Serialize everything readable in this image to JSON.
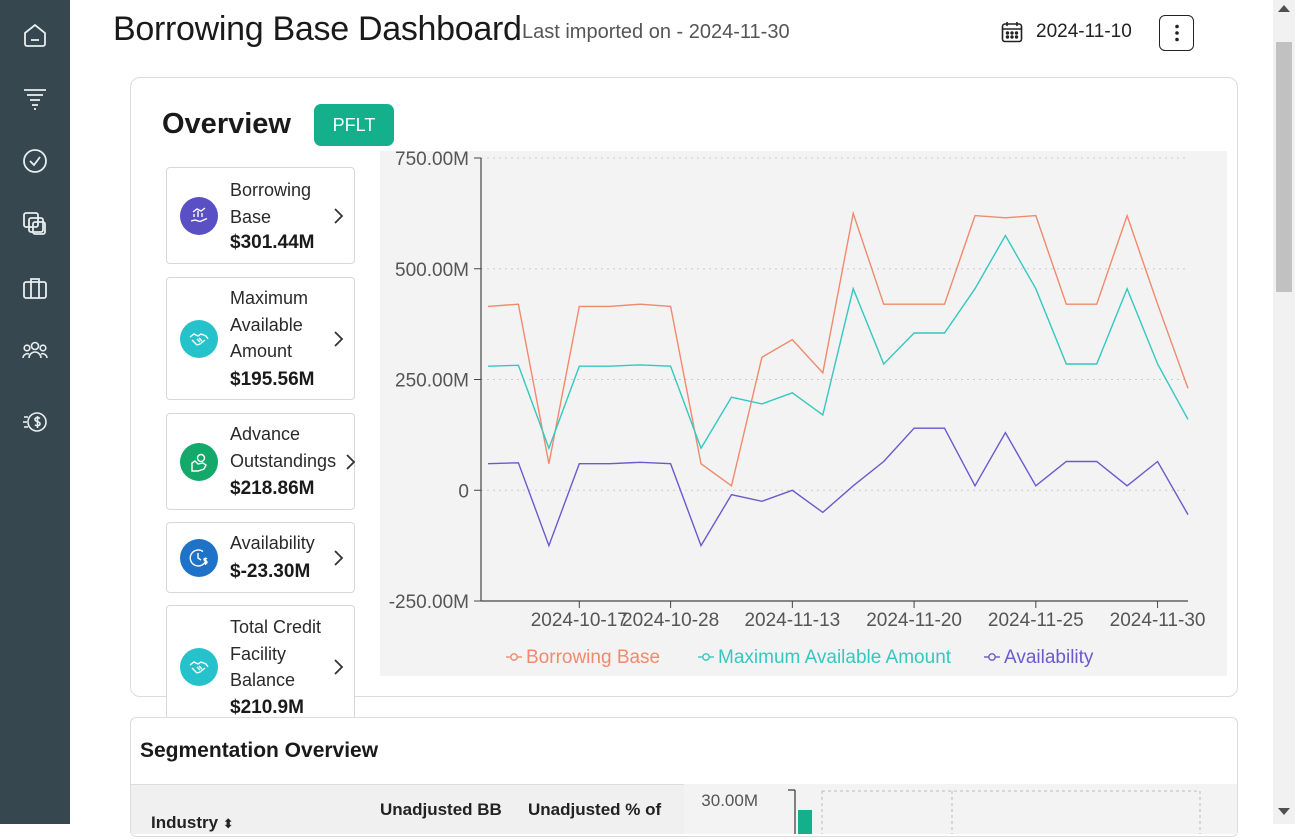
{
  "header": {
    "title": "Borrowing Base Dashboard",
    "subtitle": "Last imported on - 2024-11-30",
    "date": "2024-11-10"
  },
  "sidebar": {
    "items": [
      {
        "icon": "home-icon"
      },
      {
        "icon": "filter-icon"
      },
      {
        "icon": "check-circle-icon"
      },
      {
        "icon": "layers-icon"
      },
      {
        "icon": "briefcase-icon"
      },
      {
        "icon": "users-icon"
      },
      {
        "icon": "dollar-coin-icon"
      }
    ]
  },
  "overview": {
    "title": "Overview",
    "fund_button": "PFLT"
  },
  "metrics": [
    {
      "label_lines": [
        "Borrowing",
        "Base"
      ],
      "value": "$301.44M",
      "color": "#5b4fc4",
      "icon": "hand-chart-icon"
    },
    {
      "label_lines": [
        "Maximum",
        "Available",
        "Amount"
      ],
      "value": "$195.56M",
      "color": "#26c2cc",
      "icon": "handshake-icon"
    },
    {
      "label_lines": [
        "Advance",
        "Outstandings"
      ],
      "value": "$218.86M",
      "color": "#14a86a",
      "icon": "hand-coin-icon"
    },
    {
      "label_lines": [
        "Availability"
      ],
      "value": "$-23.30M",
      "color": "#1e73c8",
      "icon": "clock-dollar-icon"
    },
    {
      "label_lines": [
        "Total Credit",
        "Facility",
        "Balance"
      ],
      "value": "$210.9M",
      "color": "#26c2cc",
      "icon": "handshake-icon"
    }
  ],
  "chart_data": {
    "type": "line",
    "y_ticks": [
      "750.00M",
      "500.00M",
      "250.00M",
      "0",
      "-250.00M"
    ],
    "y_tick_values": [
      750,
      500,
      250,
      0,
      -250
    ],
    "ylim": [
      -250,
      750
    ],
    "x_ticks": [
      "2024-10-17",
      "2024-10-28",
      "2024-11-13",
      "2024-11-20",
      "2024-11-25",
      "2024-11-30"
    ],
    "x_tick_index": [
      3,
      6,
      10,
      14,
      18,
      22
    ],
    "point_count": 24,
    "grid": true,
    "legend_position": "bottom",
    "series": [
      {
        "name": "Borrowing Base",
        "color": "#f08a6c",
        "values": [
          415,
          420,
          60,
          415,
          415,
          420,
          415,
          60,
          10,
          300,
          340,
          265,
          625,
          420,
          420,
          420,
          620,
          615,
          620,
          420,
          420,
          620,
          420,
          230
        ]
      },
      {
        "name": "Maximum Available Amount",
        "color": "#35c8c0",
        "values": [
          280,
          282,
          95,
          280,
          280,
          283,
          280,
          95,
          210,
          195,
          220,
          170,
          455,
          285,
          355,
          355,
          455,
          575,
          455,
          285,
          285,
          455,
          285,
          160
        ]
      },
      {
        "name": "Availability",
        "color": "#6a5acd",
        "values": [
          60,
          62,
          -125,
          60,
          60,
          63,
          60,
          -125,
          -10,
          -25,
          0,
          -50,
          10,
          65,
          140,
          140,
          10,
          130,
          10,
          65,
          65,
          10,
          65,
          -55
        ]
      }
    ]
  },
  "segmentation": {
    "title": "Segmentation Overview",
    "columns": [
      "Industry",
      "Unadjusted BB",
      "Unadjusted % of"
    ],
    "sort_glyph": "⬍",
    "chart_tick": "30.00M"
  }
}
